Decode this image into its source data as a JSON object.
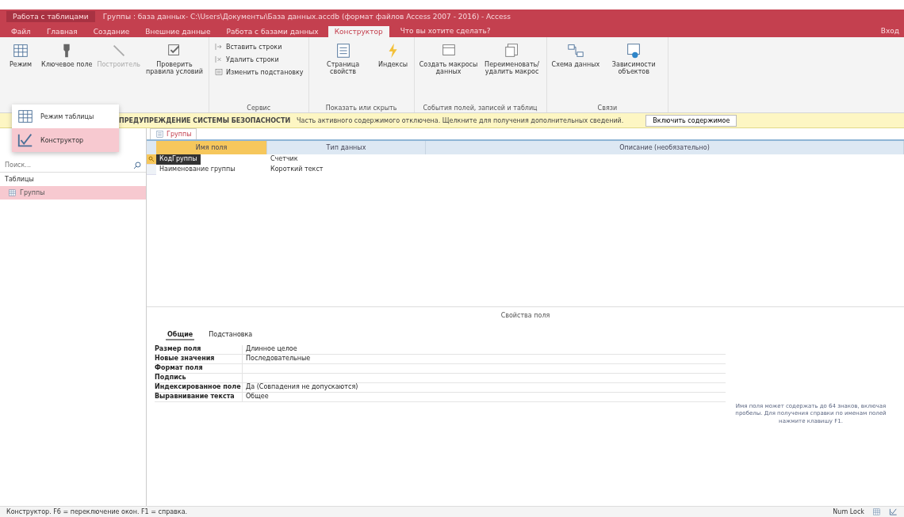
{
  "title_bar": {
    "context_label": "Работа с таблицами",
    "title": "Группы : база данных- C:\\Users\\Документы\\База данных.accdb (формат файлов Access 2007 - 2016) - Access"
  },
  "tabs": [
    {
      "label": "Файл",
      "selected": false
    },
    {
      "label": "Главная",
      "selected": false
    },
    {
      "label": "Создание",
      "selected": false
    },
    {
      "label": "Внешние данные",
      "selected": false
    },
    {
      "label": "Работа с базами данных",
      "selected": false
    },
    {
      "label": "Конструктор",
      "selected": true
    }
  ],
  "tell_me": "Что вы хотите сделать?",
  "sign_in": "Вход",
  "ribbon_groups": [
    {
      "items": [
        {
          "kind": "large",
          "label": "Режим",
          "disabled": false
        },
        {
          "kind": "large",
          "label": "Ключевое поле",
          "disabled": false
        },
        {
          "kind": "large",
          "label": "Построитель",
          "disabled": true
        },
        {
          "kind": "large",
          "label": "Проверить правила условий",
          "disabled": false
        }
      ]
    },
    {
      "label": "Сервис",
      "items": [
        {
          "kind": "small",
          "label": "Вставить строки",
          "disabled": false
        },
        {
          "kind": "small",
          "label": "Удалить строки",
          "disabled": false
        },
        {
          "kind": "small",
          "label": "Изменить подстановку",
          "disabled": false
        }
      ]
    },
    {
      "label": "Показать или скрыть",
      "items": [
        {
          "kind": "large",
          "label": "Страница свойств",
          "disabled": false
        },
        {
          "kind": "large",
          "label": "Индексы",
          "disabled": false
        }
      ]
    },
    {
      "label": "События полей, записей и таблиц",
      "items": [
        {
          "kind": "large",
          "label": "Создать макросы данных",
          "disabled": false
        },
        {
          "kind": "large",
          "label": "Переименовать/удалить макрос",
          "disabled": false
        }
      ]
    },
    {
      "label": "Связи",
      "items": [
        {
          "kind": "large",
          "label": "Схема данных",
          "disabled": false
        },
        {
          "kind": "large",
          "label": "Зависимости объектов",
          "disabled": false
        }
      ]
    }
  ],
  "view_menu": [
    {
      "label": "Режим таблицы",
      "selected": false
    },
    {
      "label": "Конструктор",
      "selected": true
    }
  ],
  "security_bar": {
    "title": "ПРЕДУПРЕЖДЕНИЕ СИСТЕМЫ БЕЗОПАСНОСТИ",
    "message": "Часть активного содержимого отключена. Щелкните для получения дополнительных сведений.",
    "button": "Включить содержимое"
  },
  "nav_pane": {
    "search_placeholder": "Поиск...",
    "section": "Таблицы",
    "items": [
      {
        "label": "Группы",
        "selected": true
      }
    ]
  },
  "document_tab": {
    "label": "Группы"
  },
  "design_grid": {
    "columns": [
      "Имя поля",
      "Тип данных",
      "Описание (необязательно)"
    ],
    "rows": [
      {
        "field": "КодГруппы",
        "type": "Счетчик",
        "key": true,
        "selected": true
      },
      {
        "field": "Наименование группы",
        "type": "Короткий текст",
        "key": false,
        "selected": false
      }
    ]
  },
  "field_properties": {
    "title": "Свойства поля",
    "tabs": [
      {
        "label": "Общие",
        "selected": true
      },
      {
        "label": "Подстановка",
        "selected": false
      }
    ],
    "rows": [
      {
        "name": "Размер поля",
        "value": "Длинное целое"
      },
      {
        "name": "Новые значения",
        "value": "Последовательные"
      },
      {
        "name": "Формат поля",
        "value": ""
      },
      {
        "name": "Подпись",
        "value": ""
      },
      {
        "name": "Индексированное поле",
        "value": "Да (Совпадения не допускаются)"
      },
      {
        "name": "Выравнивание текста",
        "value": "Общее"
      }
    ],
    "help": "Имя поля может содержать до 64 знаков, включая пробелы. Для получения справки по именам полей нажмите клавишу F1."
  },
  "status_bar": {
    "text": "Конструктор. F6 = переключение окон. F1 = справка.",
    "num_lock": "Num Lock"
  }
}
